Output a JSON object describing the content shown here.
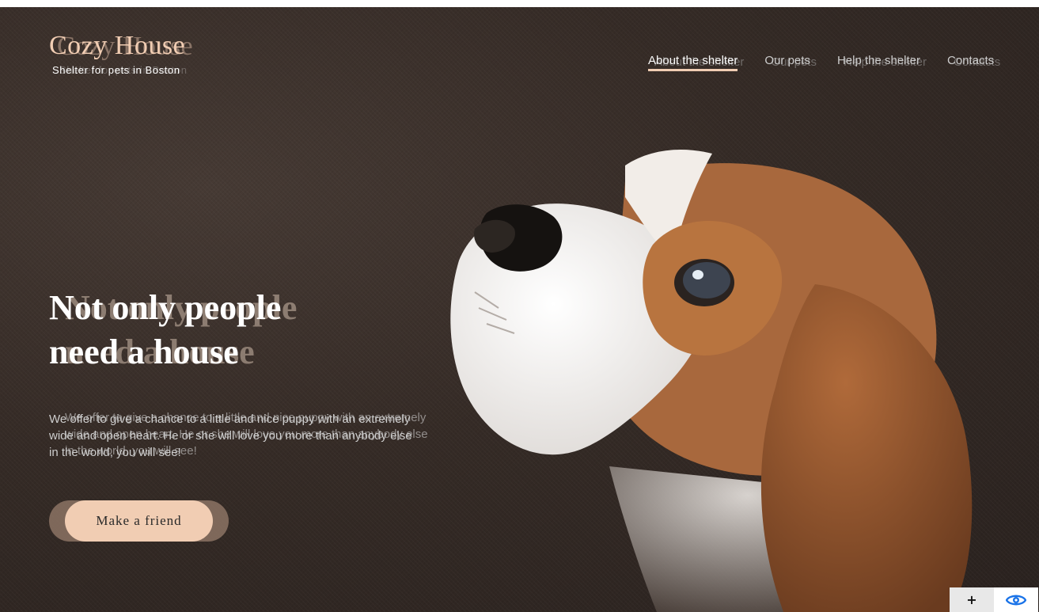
{
  "header": {
    "logo_title": "Cozy House",
    "logo_subtitle": "Shelter for pets in Boston"
  },
  "nav": {
    "items": [
      {
        "label": "About the shelter",
        "active": true
      },
      {
        "label": "Our pets",
        "active": false
      },
      {
        "label": "Help the shelter",
        "active": false
      },
      {
        "label": "Contacts",
        "active": false
      }
    ]
  },
  "hero": {
    "headline_line1": "Not only people",
    "headline_line2": "need a house",
    "description": "We offer to give a chance to a little and nice puppy with an extremely wide and open heart. He or she will love you more than anybody else in the world, you will see!",
    "cta_label": "Make a friend"
  },
  "floating_toolbar": {
    "plus_label": "+",
    "eye_icon": "eye-icon"
  },
  "colors": {
    "accent": "#f1cdb3",
    "background_dark": "#352b26",
    "text_light": "#ffffff",
    "eye_blue": "#1a73e8"
  }
}
